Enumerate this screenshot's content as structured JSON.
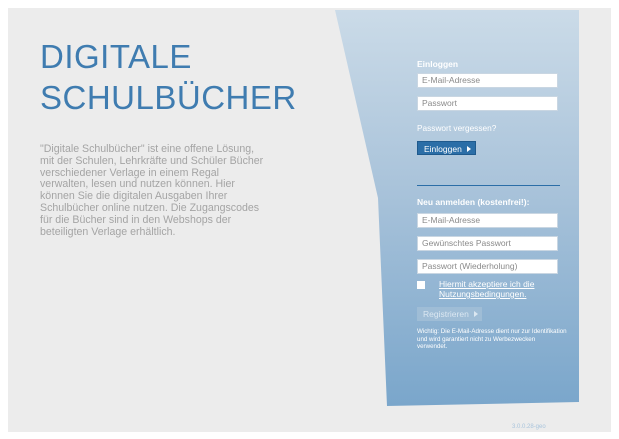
{
  "branding": {
    "title_line1": "DIGITALE",
    "title_line2": "SCHULBÜCHER"
  },
  "intro": {
    "text": "\"Digitale Schulbücher\" ist eine offene Lösung, mit der Schulen, Lehrkräfte und Schüler Bücher verschiedener Verlage in einem Regal verwalten, lesen und nutzen können. Hier können Sie die digitalen Ausgaben Ihrer Schulbücher online nutzen. Die Zugangscodes für die Bücher sind in den Webshops der beteiligten Verlage erhältlich."
  },
  "login": {
    "heading": "Einloggen",
    "email_placeholder": "E-Mail-Adresse",
    "password_placeholder": "Passwort",
    "forgot_link": "Passwort vergessen?",
    "submit_label": "Einloggen"
  },
  "register": {
    "heading": "Neu anmelden (kostenfrei!):",
    "email_placeholder": "E-Mail-Adresse",
    "password_placeholder": "Gewünschtes Passwort",
    "password_repeat_placeholder": "Passwort (Wiederholung)",
    "terms_line1": "Hiermit akzeptiere ich die",
    "terms_line2": "Nutzungsbedingungen.",
    "terms_checked": false,
    "submit_label": "Registrieren",
    "note": "Wichtig: Die E-Mail-Adresse dient nur zur Identifikation und wird garantiert nicht zu Werbezwecken verwendet."
  },
  "footer": {
    "version": "3.0.0.28-geo"
  },
  "colors": {
    "accent": "#3f7cb0",
    "button": "#2b6ea7",
    "panel_top": "#c5d6e5",
    "panel_bottom": "#7ea8cb",
    "page_bg": "#ececec"
  }
}
